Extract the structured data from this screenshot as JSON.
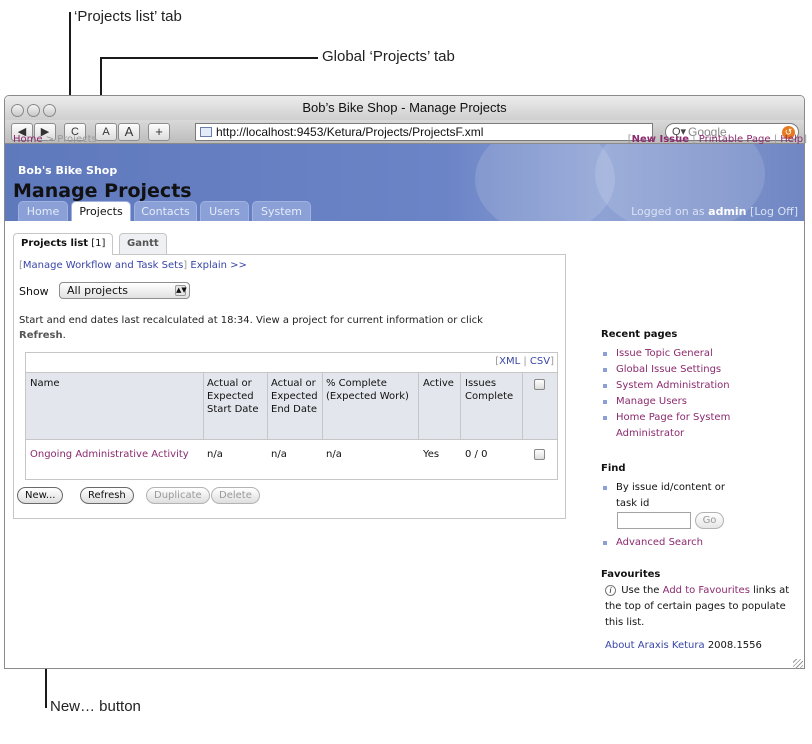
{
  "callouts": {
    "projects_list_tab": "‘Projects list’ tab",
    "global_projects_tab": "Global ‘Projects’ tab",
    "new_button": "New… button"
  },
  "browser": {
    "title": "Bob’s Bike Shop - Manage Projects",
    "url": "http://localhost:9453/Ketura/Projects/ProjectsF.xml",
    "search_placeholder": "Google",
    "toolbar_buttons": [
      "◀",
      "▶",
      "C",
      "A",
      "A",
      "+"
    ]
  },
  "site": {
    "name": "Bob's Bike Shop",
    "global_tabs": [
      "Home",
      "Projects",
      "Contacts",
      "Users",
      "System"
    ],
    "logged_on_prefix": "Logged on as",
    "logged_on_user": "admin",
    "log_off": "[Log Off]"
  },
  "breadcrumb": {
    "home": "Home",
    "separator": ">",
    "current": "Projects"
  },
  "top_links": {
    "new_issue": "New Issue",
    "printable_page": "Printable Page",
    "help": "Help"
  },
  "page_title": "Manage Projects",
  "project_tabs": {
    "list_label": "Projects list",
    "list_count": "[1]",
    "gantt_label": "Gantt"
  },
  "panel": {
    "manage_link": "Manage Workflow and Task Sets",
    "explain_link": "Explain >>",
    "show_label": "Show",
    "show_selected": "All projects",
    "note_text": "Start and end dates last recalculated at 18:34. View a project for current information or click",
    "note_refresh": "Refresh",
    "xml_link": "XML",
    "csv_link": "CSV"
  },
  "table": {
    "headers": {
      "name": "Name",
      "start": "Actual or Expected Start Date",
      "end": "Actual or Expected End Date",
      "complete": "% Complete (Expected Work)",
      "active": "Active",
      "issues": "Issues Complete"
    },
    "rows": [
      {
        "name": "Ongoing Administrative Activity",
        "start": "n/a",
        "end": "n/a",
        "complete": "n/a",
        "active": "Yes",
        "issues": "0 / 0"
      }
    ]
  },
  "buttons": {
    "new": "New...",
    "refresh": "Refresh",
    "duplicate": "Duplicate",
    "delete": "Delete"
  },
  "sidebar": {
    "recent_title": "Recent pages",
    "recent_items": [
      "Issue Topic General",
      "Global Issue Settings",
      "System Administration",
      "Manage Users",
      "Home Page for System Administrator"
    ],
    "find_title": "Find",
    "find_text": "By issue id/content or task id",
    "go_label": "Go",
    "advanced_search": "Advanced Search",
    "favourites_title": "Favourites",
    "fav_pre": "Use the",
    "fav_link": "Add to Favourites",
    "fav_post": "links at the top of certain pages to populate this list.",
    "about_link": "About Araxis Ketura",
    "version": "2008.1556"
  },
  "colors": {
    "banner": "#6b84c6",
    "link_purple": "#8b2a6e",
    "link_blue": "#3845a6"
  }
}
